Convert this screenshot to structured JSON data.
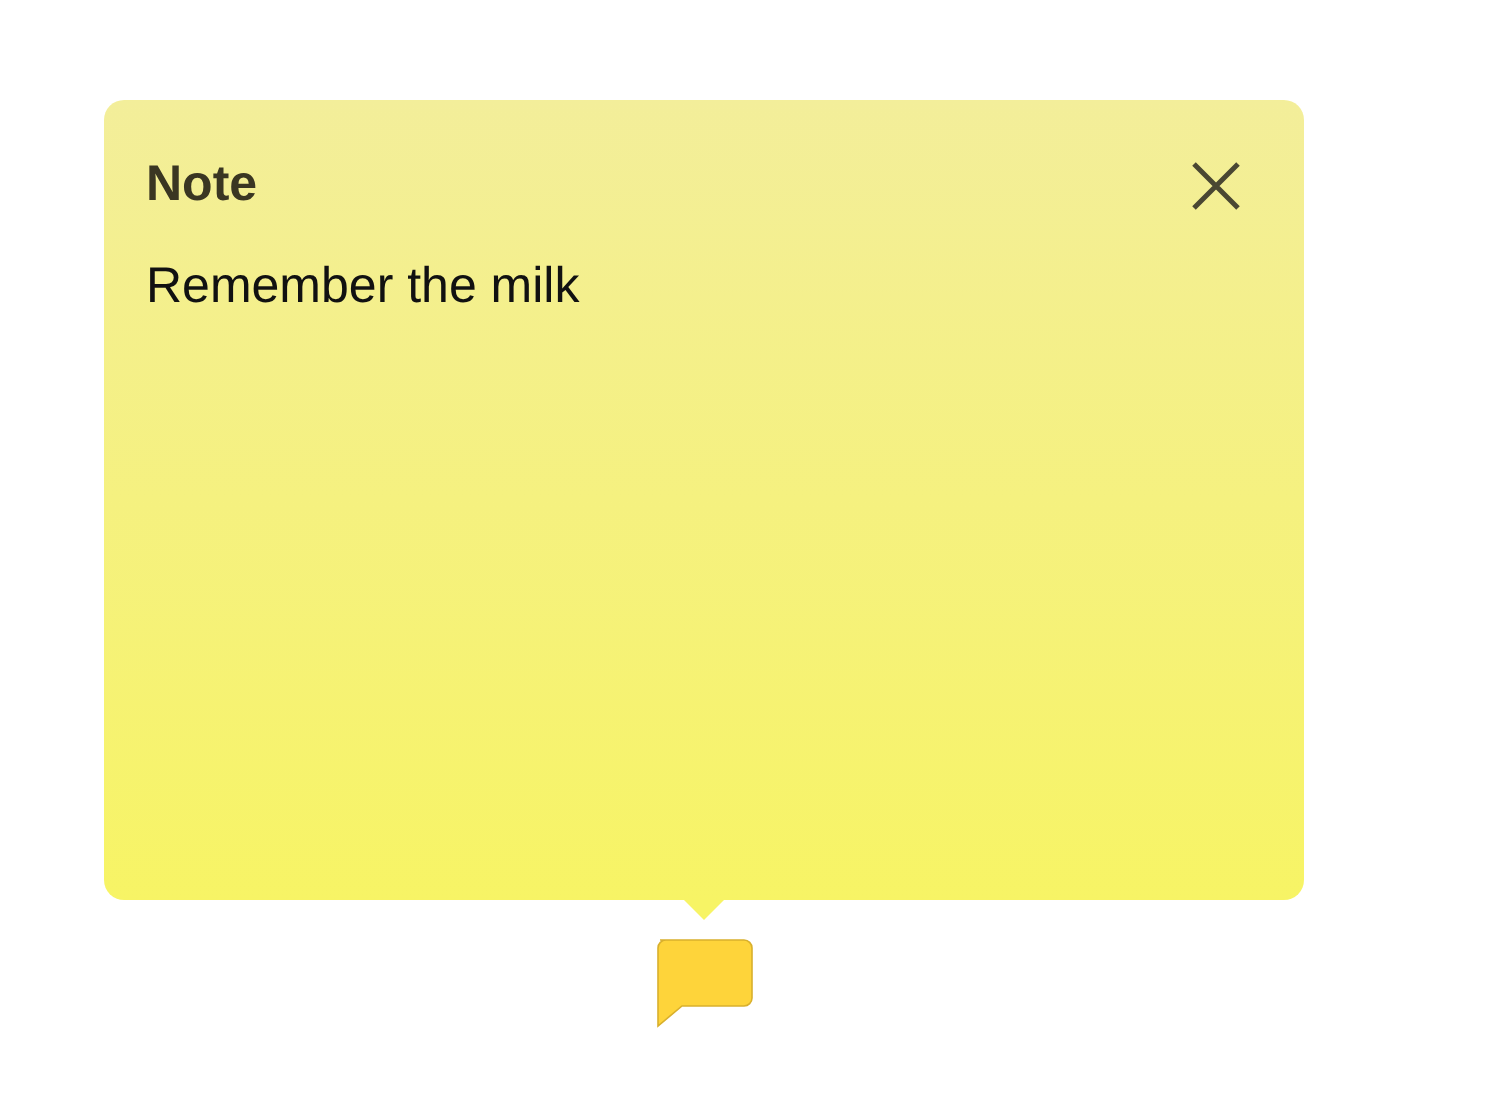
{
  "note": {
    "title": "Note",
    "body": "Remember the milk"
  }
}
